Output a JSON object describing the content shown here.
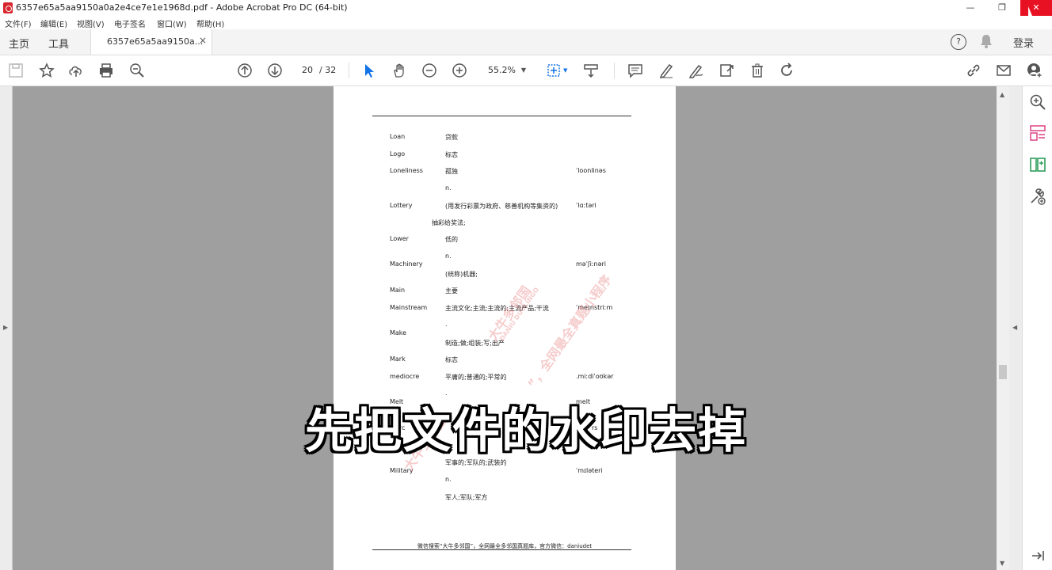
{
  "window": {
    "title": "6357e65a5aa9150a0a2e4ce7e1e1968d.pdf - Adobe Acrobat Pro DC (64-bit)",
    "minimize": "—",
    "maximize": "❐",
    "close": "✕"
  },
  "menu": [
    "文件(F)",
    "编辑(E)",
    "视图(V)",
    "电子签名",
    "窗口(W)",
    "帮助(H)"
  ],
  "tabs": {
    "home": "主页",
    "tools": "工具",
    "document": "6357e65a5aa9150a...",
    "close": "×",
    "help": "?",
    "login": "登录"
  },
  "toolbar": {
    "page_current": "20",
    "page_total": "/ 32",
    "zoom": "55.2%"
  },
  "document": {
    "entries": [
      {
        "word": "Loan",
        "meaning": "贷款",
        "ipa": ""
      },
      {
        "word": "Logo",
        "meaning": "标志",
        "ipa": ""
      },
      {
        "word": "Loneliness",
        "meaning": "孤独",
        "ipa": "ˈloonlinəs"
      },
      {
        "word": "",
        "meaning": "n.",
        "ipa": ""
      },
      {
        "word": "Lottery",
        "meaning": "(用发行彩票为政府、慈善机构等集资的)",
        "ipa": "ˈlɑːtəri"
      },
      {
        "word": "",
        "meaning": "抽彩给奖法;",
        "ipa": ""
      },
      {
        "word": "Lower",
        "meaning": "低的",
        "ipa": ""
      },
      {
        "word": "",
        "meaning": "n.",
        "ipa": ""
      },
      {
        "word": "Machinery",
        "meaning": "",
        "ipa": "məˈʃiːnəri"
      },
      {
        "word": "",
        "meaning": "(统称)机器;",
        "ipa": ""
      },
      {
        "word": "Main",
        "meaning": "主要",
        "ipa": ""
      },
      {
        "word": "Mainstream",
        "meaning": "主流文化;主流;主流的;主流产品;干流",
        "ipa": "ˈmeɪnstriːm"
      },
      {
        "word": "",
        "meaning": ".",
        "ipa": ""
      },
      {
        "word": "Make",
        "meaning": "",
        "ipa": ""
      },
      {
        "word": "",
        "meaning": "制造;做;组装;写;出产",
        "ipa": ""
      },
      {
        "word": "Mark",
        "meaning": "标志",
        "ipa": ""
      },
      {
        "word": "mediocre",
        "meaning": "平庸的;普通的;平常的",
        "ipa": ".miːdiˈoʊkər"
      },
      {
        "word": "",
        "meaning": ".",
        "ipa": ""
      },
      {
        "word": "Melt",
        "meaning": "",
        "ipa": "melt"
      },
      {
        "word": "Merc",
        "meaning": "",
        "ipa": "rs"
      },
      {
        "word": "",
        "meaning": "军事的;军队的;武装的",
        "ipa": ""
      },
      {
        "word": "Military",
        "meaning": "",
        "ipa": "ˈmɪləteri"
      },
      {
        "word": "",
        "meaning": "n.",
        "ipa": ""
      },
      {
        "word": "",
        "meaning": "军人;军队;军方",
        "ipa": ""
      }
    ],
    "footer": "微信搜索“大牛多邻国”，全网最全多邻国真题库，官方微信：daniudet",
    "watermark1": "大牛多邻国",
    "watermark2": "DANIU DUOLINGO",
    "watermark3": "”，全网最全真题小程序",
    "watermark4": "大牛多邻国"
  },
  "subtitle": "先把文件的水印去掉",
  "colors": {
    "close": "#e81123",
    "accent": "#1473e6",
    "pink": "#e04e8c",
    "green": "#2d9d5a"
  }
}
